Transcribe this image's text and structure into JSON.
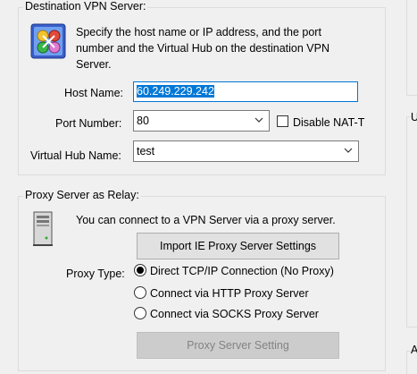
{
  "vpn": {
    "legend": "Destination VPN Server:",
    "description": "Specify the host name or IP address, and the port number and the Virtual Hub on the destination VPN Server.",
    "host_label": "Host Name:",
    "host_value": "60.249.229.242",
    "port_label": "Port Number:",
    "port_value": "80",
    "disable_natt_label": "Disable NAT-T",
    "disable_natt_checked": false,
    "hub_label": "Virtual Hub Name:",
    "hub_value": "test"
  },
  "proxy": {
    "legend": "Proxy Server as Relay:",
    "description": "You can connect to a VPN Server via a proxy server.",
    "import_button": "Import IE Proxy Server Settings",
    "type_label": "Proxy Type:",
    "options": [
      {
        "label": "Direct TCP/IP Connection (No Proxy)",
        "selected": true
      },
      {
        "label": "Connect via HTTP Proxy Server",
        "selected": false
      },
      {
        "label": "Connect via SOCKS Proxy Server",
        "selected": false
      }
    ],
    "setting_button": "Proxy Server Setting"
  },
  "right_panel": {
    "partial_letter_1": "U",
    "partial_letter_2": "A"
  },
  "colors": {
    "selection_highlight": "#0078d7",
    "focus_border": "#0078d7"
  }
}
